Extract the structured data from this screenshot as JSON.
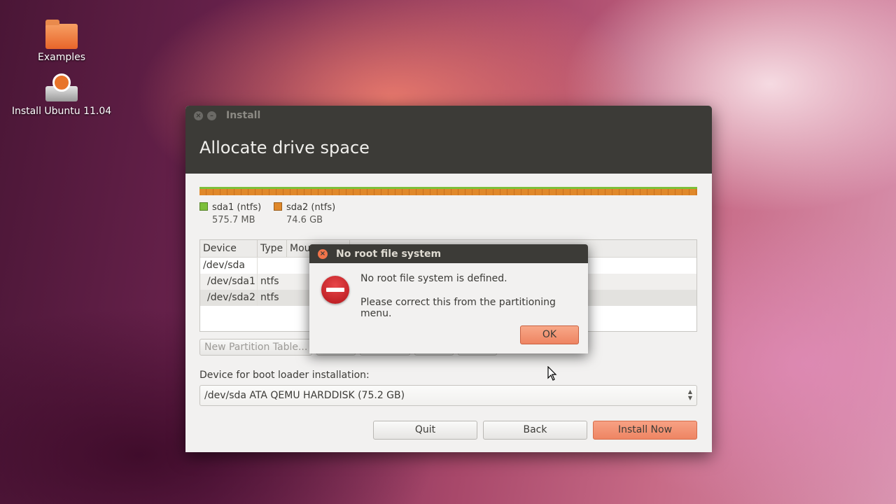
{
  "desktop": {
    "icons": [
      {
        "label": "Examples"
      },
      {
        "label": "Install Ubuntu 11.04"
      }
    ]
  },
  "window": {
    "title": "Install",
    "heading": "Allocate drive space",
    "legend": [
      {
        "name": "sda1 (ntfs)",
        "size": "575.7 MB",
        "color": "#7cbf3a"
      },
      {
        "name": "sda2 (ntfs)",
        "size": "74.6 GB",
        "color": "#e0882a"
      }
    ],
    "table": {
      "headers": [
        "Device",
        "Type",
        "Mou"
      ],
      "rows": [
        {
          "device": "/dev/sda",
          "type": ""
        },
        {
          "device": "/dev/sda1",
          "type": "ntfs"
        },
        {
          "device": "/dev/sda2",
          "type": "ntfs"
        }
      ]
    },
    "new_partition_table_label": "New Partition Table...",
    "boot_loader_label": "Device for boot loader installation:",
    "boot_loader_value": "/dev/sda ATA QEMU HARDDISK (75.2 GB)",
    "buttons": {
      "quit": "Quit",
      "back": "Back",
      "install_now": "Install Now"
    }
  },
  "dialog": {
    "title": "No root file system",
    "message": "No root file system is defined.",
    "detail": "Please correct this from the partitioning menu.",
    "ok_label": "OK"
  },
  "colors": {
    "accent": "#ee8462",
    "titlebar": "#3c3b37",
    "error": "#c91f25"
  }
}
